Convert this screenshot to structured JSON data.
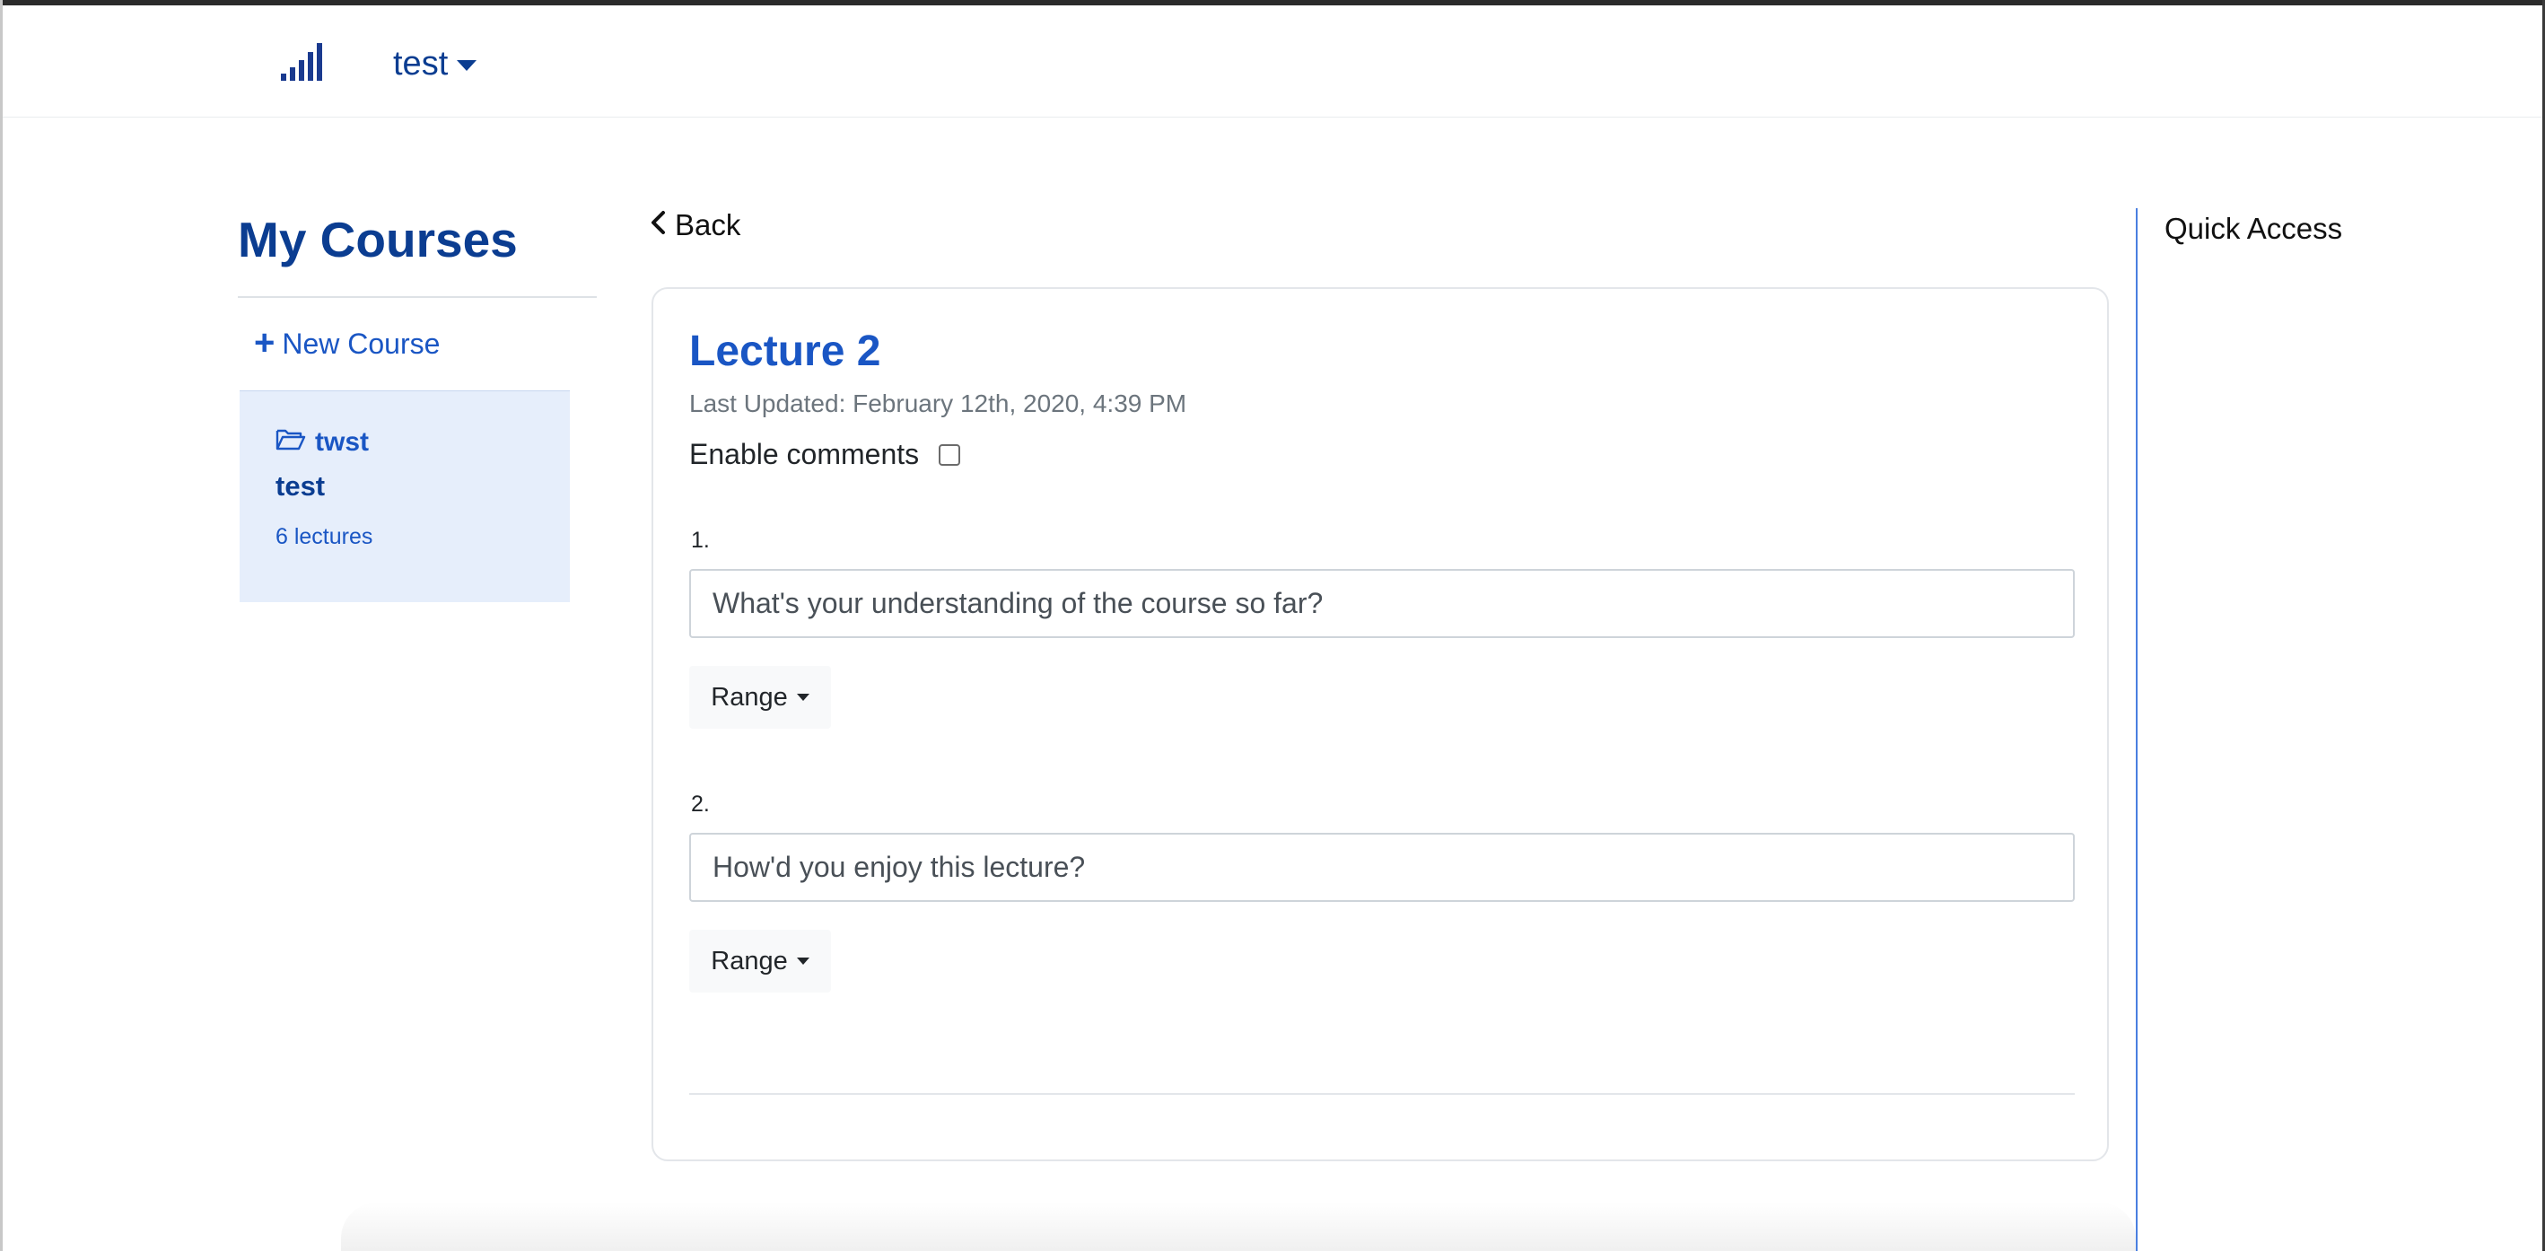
{
  "navbar": {
    "user_label": "test"
  },
  "sidebar": {
    "title": "My Courses",
    "new_course_label": "New Course",
    "courses": [
      {
        "folder": "twst",
        "name": "test",
        "lectures": "6 lectures"
      }
    ]
  },
  "main": {
    "back_label": "Back",
    "lecture_title": "Lecture 2",
    "last_updated": "Last Updated: February 12th, 2020, 4:39 PM",
    "enable_comments_label": "Enable comments",
    "enable_comments_checked": false,
    "questions": [
      {
        "number": "1.",
        "text": "What's your understanding of the course so far?",
        "type_label": "Range"
      },
      {
        "number": "2.",
        "text": "How'd you enjoy this lecture?",
        "type_label": "Range"
      }
    ]
  },
  "quick_access": {
    "title": "Quick Access"
  },
  "colors": {
    "brand_dark": "#0b3d91",
    "brand": "#1a56c4",
    "course_card_bg": "#e6eefb",
    "muted": "#6c757d"
  }
}
